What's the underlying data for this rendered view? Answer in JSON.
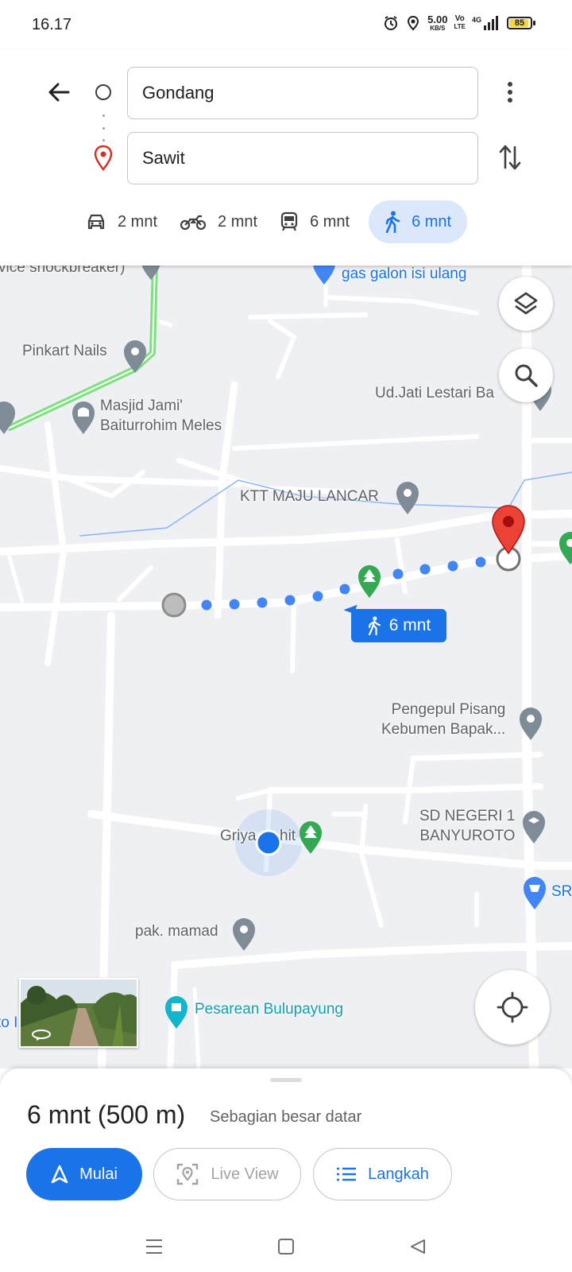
{
  "status_bar": {
    "time": "16.17",
    "speed_value": "5.00",
    "speed_unit": "KB/S",
    "volte_top": "Vo",
    "volte_bottom": "LTE",
    "network": "4G",
    "battery_level": "85",
    "battery_fraction": 0.85
  },
  "directions": {
    "origin": "Gondang",
    "destination": "Sawit",
    "modes": [
      {
        "icon": "car-icon",
        "label": "2 mnt",
        "active": false
      },
      {
        "icon": "motorcycle-icon",
        "label": "2 mnt",
        "active": false
      },
      {
        "icon": "transit-icon",
        "label": "6 mnt",
        "active": false
      },
      {
        "icon": "walk-icon",
        "label": "6 mnt",
        "active": true
      }
    ]
  },
  "map": {
    "labels": {
      "shockbreaker": "vice shockbreaker)",
      "gas": "gas galon isi ulang",
      "pinkart": "Pinkart Nails",
      "masjid": "Masjid Jami'\nBaiturrohim Meles",
      "jati": "Ud.Jati Lestari Ba",
      "ktt": "KTT MAJU LANCAR",
      "pengepul": "Pengepul Pisang\nKebumen Bapak...",
      "griya": "Griya",
      "griya_suffix": "hit",
      "sd": "SD NEGERI 1\nBANYUROTO",
      "sr": "SR",
      "mamad": "pak. mamad",
      "pesarean": "Pesarean Bulupayung",
      "edge_left": "to I"
    },
    "route_badge": "6 mnt",
    "colors": {
      "route": "#4285f4",
      "accent": "#1a73e8",
      "destination_pin": "#ea4335",
      "park_pin": "#34a853",
      "road_highlight": "#7ee07e"
    }
  },
  "summary": {
    "time_distance": "6 mnt (500 m)",
    "note": "Sebagian besar datar"
  },
  "actions": {
    "start": "Mulai",
    "live_view": "Live View",
    "steps": "Langkah"
  }
}
